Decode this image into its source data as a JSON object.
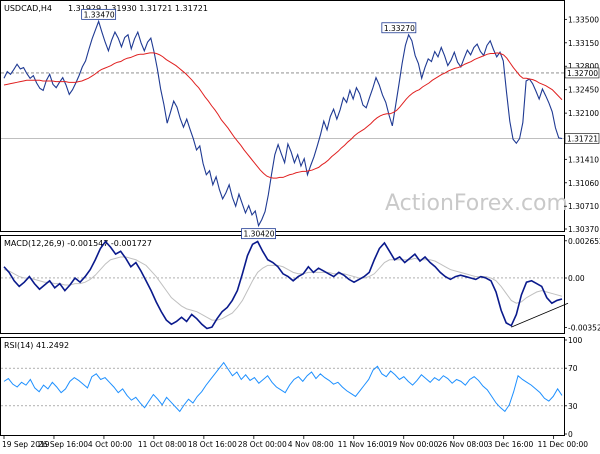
{
  "chart_data": [
    {
      "type": "line",
      "panel": "price",
      "symbol_header": "USDCAD,H4",
      "ohlc_header": "1.31929 1.31930 1.31721 1.31721",
      "y_ticks": [
        "1.33500",
        "1.33150",
        "1.32800",
        "1.32450",
        "1.32100",
        "1.31410",
        "1.31060",
        "1.30710",
        "1.30370"
      ],
      "ylim": [
        1.3037,
        1.3358
      ],
      "price_series": [
        1.3262,
        1.3272,
        1.3268,
        1.3275,
        1.3283,
        1.3276,
        1.3278,
        1.3269,
        1.3262,
        1.3266,
        1.3255,
        1.3247,
        1.3244,
        1.3259,
        1.3268,
        1.3253,
        1.3248,
        1.3256,
        1.3263,
        1.3252,
        1.3238,
        1.3245,
        1.3255,
        1.3266,
        1.3279,
        1.3288,
        1.3305,
        1.3321,
        1.3334,
        1.3347,
        1.3331,
        1.3316,
        1.3303,
        1.3319,
        1.3331,
        1.3322,
        1.3309,
        1.3323,
        1.3327,
        1.3306,
        1.3321,
        1.3331,
        1.3315,
        1.3303,
        1.3316,
        1.3322,
        1.3301,
        1.3276,
        1.3246,
        1.3223,
        1.3195,
        1.3211,
        1.3228,
        1.3219,
        1.3202,
        1.3189,
        1.3201,
        1.3186,
        1.3172,
        1.3155,
        1.3161,
        1.3135,
        1.3118,
        1.3124,
        1.3103,
        1.3115,
        1.3096,
        1.3082,
        1.3091,
        1.3103,
        1.3084,
        1.3071,
        1.3089,
        1.3075,
        1.3061,
        1.3072,
        1.3058,
        1.3064,
        1.3042,
        1.3051,
        1.3063,
        1.3088,
        1.3119,
        1.3148,
        1.3163,
        1.3149,
        1.3136,
        1.3164,
        1.3152,
        1.3136,
        1.3148,
        1.3131,
        1.3142,
        1.3118,
        1.3132,
        1.3145,
        1.3161,
        1.3178,
        1.3198,
        1.3185,
        1.3205,
        1.3216,
        1.3201,
        1.3215,
        1.3233,
        1.3226,
        1.3244,
        1.3231,
        1.3248,
        1.3239,
        1.3222,
        1.3218,
        1.3233,
        1.3247,
        1.3263,
        1.3252,
        1.3237,
        1.3226,
        1.3207,
        1.3191,
        1.3221,
        1.3252,
        1.3284,
        1.3311,
        1.3327,
        1.3318,
        1.3296,
        1.3284,
        1.3262,
        1.3278,
        1.3291,
        1.3287,
        1.3302,
        1.3294,
        1.3308,
        1.3296,
        1.3281,
        1.3289,
        1.3301,
        1.3286,
        1.3279,
        1.3292,
        1.3304,
        1.3297,
        1.3308,
        1.3313,
        1.3302,
        1.3296,
        1.3311,
        1.3318,
        1.3305,
        1.3294,
        1.3301,
        1.3288,
        1.3241,
        1.3198,
        1.3171,
        1.3165,
        1.3172,
        1.3196,
        1.3258,
        1.3261,
        1.3254,
        1.3243,
        1.3231,
        1.3246,
        1.3236,
        1.3225,
        1.3212,
        1.3188,
        1.3173,
        1.3172
      ],
      "ma_series": [
        1.3252,
        1.3253,
        1.3254,
        1.3255,
        1.3256,
        1.3257,
        1.3258,
        1.3259,
        1.3259,
        1.3259,
        1.3259,
        1.3259,
        1.3258,
        1.3258,
        1.3258,
        1.3258,
        1.3257,
        1.3257,
        1.3257,
        1.3257,
        1.3256,
        1.3256,
        1.3256,
        1.3257,
        1.3258,
        1.326,
        1.3262,
        1.3265,
        1.3268,
        1.3272,
        1.3275,
        1.3277,
        1.3279,
        1.3281,
        1.3284,
        1.3286,
        1.3287,
        1.329,
        1.3292,
        1.3293,
        1.3295,
        1.3297,
        1.3298,
        1.3298,
        1.3299,
        1.33,
        1.33,
        1.3299,
        1.3297,
        1.3294,
        1.329,
        1.3287,
        1.3284,
        1.3281,
        1.3277,
        1.3273,
        1.3269,
        1.3264,
        1.3259,
        1.3253,
        1.3248,
        1.3241,
        1.3234,
        1.3228,
        1.3221,
        1.3215,
        1.3208,
        1.32,
        1.3194,
        1.3188,
        1.3181,
        1.3174,
        1.3168,
        1.3162,
        1.3155,
        1.3149,
        1.3143,
        1.3137,
        1.3131,
        1.3125,
        1.312,
        1.3116,
        1.3114,
        1.3113,
        1.3113,
        1.3114,
        1.3114,
        1.3116,
        1.3118,
        1.3119,
        1.3121,
        1.3122,
        1.3123,
        1.3123,
        1.3124,
        1.3125,
        1.3127,
        1.3129,
        1.3133,
        1.3136,
        1.314,
        1.3145,
        1.3149,
        1.3153,
        1.3158,
        1.3162,
        1.3167,
        1.3171,
        1.3176,
        1.318,
        1.3183,
        1.3186,
        1.319,
        1.3194,
        1.3199,
        1.3203,
        1.3206,
        1.3208,
        1.3209,
        1.3209,
        1.3211,
        1.3214,
        1.3219,
        1.3225,
        1.3231,
        1.3236,
        1.324,
        1.3243,
        1.3245,
        1.3249,
        1.3252,
        1.3255,
        1.3259,
        1.3262,
        1.3265,
        1.3268,
        1.327,
        1.3273,
        1.3275,
        1.3277,
        1.3278,
        1.328,
        1.3283,
        1.3285,
        1.3287,
        1.329,
        1.3292,
        1.3294,
        1.3296,
        1.3298,
        1.3299,
        1.3299,
        1.33,
        1.3299,
        1.3297,
        1.3292,
        1.3285,
        1.3278,
        1.3272,
        1.3266,
        1.3262,
        1.3262,
        1.3261,
        1.326,
        1.3258,
        1.3255,
        1.3253,
        1.3251,
        1.3248,
        1.3245,
        1.324,
        1.3235,
        1.323
      ],
      "hline_levels": [
        1.327,
        1.31721
      ],
      "price_labels": [
        {
          "text": "1.33470",
          "index": 29,
          "price": 1.3347,
          "position": "above"
        },
        {
          "text": "1.30420",
          "index": 78,
          "price": 1.3042,
          "position": "below"
        },
        {
          "text": "1.33270",
          "index": 121,
          "price": 1.3327,
          "position": "above"
        }
      ],
      "axis_markers": [
        {
          "text": "1.32700",
          "price": 1.327,
          "bg": "#ffffff"
        },
        {
          "text": "1.31721",
          "price": 1.31721,
          "bg": "#ffffff"
        }
      ],
      "watermark": "ActionForex.com"
    },
    {
      "type": "line",
      "panel": "macd",
      "header": "MACD(12,26,9) -0.001547 -0.001727",
      "y_ticks": [
        "0.002652",
        "0.00",
        "-0.003526"
      ],
      "ylim": [
        -0.00385,
        0.00285
      ],
      "tick_values": [
        0.002652,
        0.0,
        -0.003526
      ],
      "macd_series": [
        0.0008,
        0.0004,
        -0.0002,
        -0.0006,
        -0.0003,
        0.0001,
        -0.0004,
        -0.0008,
        -0.0005,
        -0.0002,
        -0.0007,
        -0.0004,
        -0.0009,
        -0.0005,
        0.0,
        -0.0003,
        0.0001,
        0.0006,
        0.0013,
        0.0021,
        0.0026,
        0.0022,
        0.0017,
        0.0019,
        0.0014,
        0.0008,
        0.0011,
        0.0005,
        -0.0002,
        -0.0009,
        -0.0017,
        -0.0024,
        -0.003,
        -0.0033,
        -0.0031,
        -0.0028,
        -0.0031,
        -0.0026,
        -0.0029,
        -0.0033,
        -0.0036,
        -0.0035,
        -0.0029,
        -0.0024,
        -0.0021,
        -0.0016,
        -0.0009,
        0.0003,
        0.0016,
        0.0024,
        0.0026,
        0.0019,
        0.0013,
        0.0011,
        0.0008,
        0.0003,
        0.0001,
        -0.0002,
        0.0001,
        0.0003,
        0.0008,
        0.0004,
        0.0007,
        0.0005,
        0.0003,
        0.0001,
        0.0004,
        0.0002,
        -0.0001,
        -0.0003,
        -0.0001,
        0.0001,
        0.0004,
        0.0013,
        0.0021,
        0.0025,
        0.0019,
        0.0013,
        0.0015,
        0.0011,
        0.0014,
        0.0017,
        0.0012,
        0.0015,
        0.0011,
        0.0008,
        0.0004,
        0.0001,
        -0.0001,
        0.0001,
        0.0002,
        0.0001,
        0.0,
        -0.0001,
        0.0001,
        0.0,
        -0.0002,
        -0.001,
        -0.0023,
        -0.0032,
        -0.0034,
        -0.0026,
        -0.0012,
        -0.0003,
        -0.0002,
        -0.0004,
        -0.0006,
        -0.0014,
        -0.0018,
        -0.0016,
        -0.0015
      ],
      "signal_series": [
        0.0006,
        0.0005,
        0.0003,
        0.0001,
        0.0,
        0.0,
        -0.0001,
        -0.0002,
        -0.0003,
        -0.0003,
        -0.0004,
        -0.0004,
        -0.0005,
        -0.0005,
        -0.0004,
        -0.0004,
        -0.0003,
        -0.0001,
        0.0002,
        0.0006,
        0.001,
        0.0013,
        0.0014,
        0.0015,
        0.0015,
        0.0014,
        0.0013,
        0.0011,
        0.0009,
        0.0005,
        0.0001,
        -0.0004,
        -0.0009,
        -0.0014,
        -0.0017,
        -0.002,
        -0.0022,
        -0.0023,
        -0.0024,
        -0.0026,
        -0.0028,
        -0.003,
        -0.003,
        -0.0029,
        -0.0027,
        -0.0025,
        -0.0021,
        -0.0016,
        -0.0009,
        -0.0002,
        0.0004,
        0.0007,
        0.0009,
        0.0009,
        0.0009,
        0.0008,
        0.0006,
        0.0004,
        0.0003,
        0.0003,
        0.0004,
        0.0004,
        0.0004,
        0.0004,
        0.0004,
        0.0003,
        0.0003,
        0.0003,
        0.0002,
        0.0001,
        0.0,
        0.0,
        0.0001,
        0.0003,
        0.0007,
        0.0011,
        0.0013,
        0.0013,
        0.0013,
        0.0013,
        0.0013,
        0.0014,
        0.0013,
        0.0013,
        0.0013,
        0.0012,
        0.001,
        0.0008,
        0.0006,
        0.0005,
        0.0004,
        0.0003,
        0.0002,
        0.0001,
        0.0001,
        0.0001,
        0.0,
        -0.0002,
        -0.0006,
        -0.0011,
        -0.0016,
        -0.0018,
        -0.0017,
        -0.0014,
        -0.0012,
        -0.001,
        -0.0009,
        -0.001,
        -0.0011,
        -0.0012,
        -0.0013
      ],
      "trendline": [
        [
          100,
          -0.0035
        ],
        [
          110,
          -0.0018
        ]
      ]
    },
    {
      "type": "line",
      "panel": "rsi",
      "header": "RSI(14) 41.2492",
      "y_ticks": [
        "100",
        "70",
        "30",
        "0"
      ],
      "ylim": [
        0,
        100
      ],
      "tick_values": [
        100,
        70,
        30,
        0
      ],
      "guide_levels": [
        70,
        30
      ],
      "rsi_series": [
        56,
        59,
        53,
        50,
        55,
        52,
        58,
        49,
        45,
        52,
        48,
        55,
        50,
        44,
        48,
        56,
        60,
        57,
        53,
        49,
        61,
        64,
        58,
        60,
        55,
        50,
        44,
        48,
        41,
        36,
        39,
        33,
        28,
        35,
        42,
        37,
        31,
        39,
        34,
        29,
        24,
        31,
        37,
        33,
        40,
        45,
        52,
        58,
        64,
        70,
        76,
        69,
        62,
        66,
        58,
        63,
        57,
        60,
        54,
        58,
        62,
        55,
        50,
        47,
        44,
        52,
        58,
        61,
        56,
        62,
        66,
        59,
        64,
        60,
        57,
        53,
        55,
        50,
        46,
        43,
        40,
        46,
        52,
        58,
        68,
        72,
        64,
        61,
        67,
        63,
        58,
        61,
        56,
        52,
        57,
        63,
        59,
        55,
        60,
        57,
        62,
        59,
        54,
        58,
        56,
        52,
        58,
        61,
        57,
        51,
        47,
        40,
        33,
        28,
        24,
        31,
        45,
        62,
        58,
        55,
        52,
        48,
        44,
        38,
        35,
        40,
        48,
        41
      ]
    }
  ],
  "x_axis": {
    "labels": [
      "19 Sep 2019",
      "26 Sep 16:00",
      "4 Oct 00:00",
      "11 Oct 08:00",
      "18 Oct 16:00",
      "28 Oct 00:00",
      "4 Nov 08:00",
      "11 Nov 16:00",
      "19 Nov 00:00",
      "26 Nov 08:00",
      "3 Dec 16:00",
      "11 Dec 00:00"
    ]
  },
  "colors": {
    "price_line": "#1f3a93",
    "ma_line": "#e02020",
    "macd_line": "#0a1a8c",
    "signal_line": "#c0c0c0",
    "rsi_line": "#1e90ff",
    "grid_dotted": "#808080",
    "axis_text": "#000000"
  }
}
